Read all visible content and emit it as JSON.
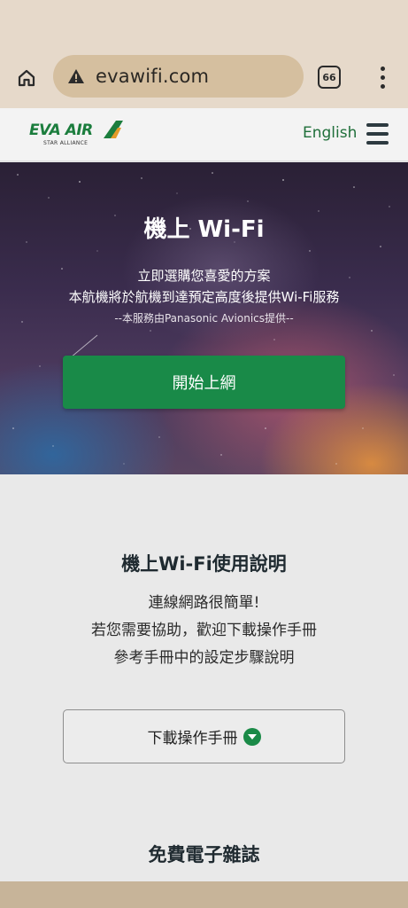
{
  "browser": {
    "url": "evawifi.com",
    "tab_count": "66"
  },
  "header": {
    "logo_text": "EVA AIR",
    "logo_subtext": "STAR ALLIANCE",
    "language_label": "English"
  },
  "hero": {
    "title": "機上 Wi-Fi",
    "line1": "立即選購您喜愛的方案",
    "line2": "本航機將於航機到達預定高度後提供Wi-Fi服務",
    "line3": "--本服務由Panasonic Avionics提供--",
    "cta_label": "開始上網"
  },
  "guide": {
    "title": "機上Wi-Fi使用說明",
    "line1": "連線網路很簡單!",
    "line2": "若您需要協助，歡迎下載操作手冊",
    "line3": "參考手冊中的設定步驟說明",
    "download_label": "下載操作手冊"
  },
  "magazine": {
    "title": "免費電子雜誌"
  },
  "colors": {
    "brand_green": "#198a48",
    "browser_bar": "#e6d9ca",
    "url_pill": "#d5bf9f"
  },
  "icons": [
    "home-icon",
    "warning-icon",
    "tabs-icon",
    "more-vert-icon",
    "hamburger-icon",
    "download-chevron-icon"
  ]
}
